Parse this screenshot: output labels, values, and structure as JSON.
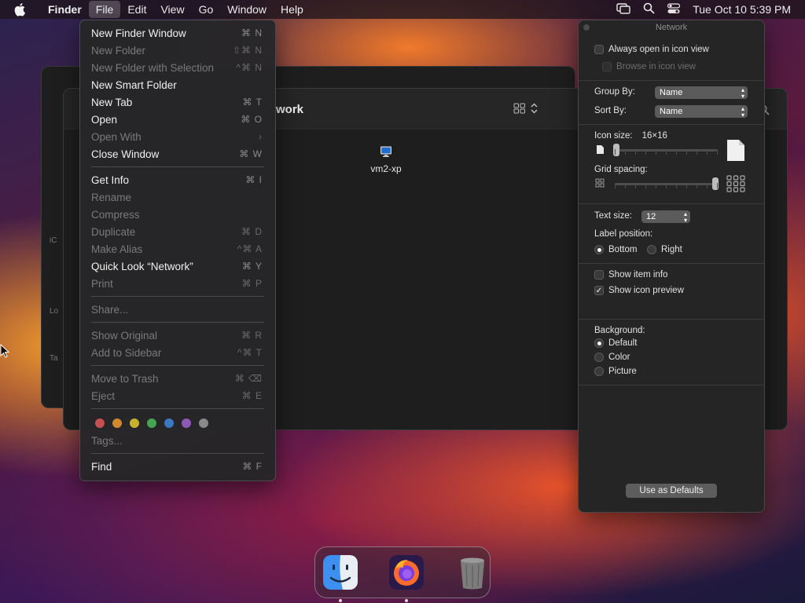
{
  "menubar": {
    "app_name": "Finder",
    "items": [
      "File",
      "Edit",
      "View",
      "Go",
      "Window",
      "Help"
    ],
    "clock": "Tue Oct 10  5:39 PM"
  },
  "finder_window": {
    "title_fragment": "work",
    "file_item": {
      "label": "vm2-xp"
    }
  },
  "background_window": {
    "ghost_labels": [
      "iC",
      "Lo",
      "Ta"
    ]
  },
  "file_menu": {
    "items": [
      {
        "label": "New Finder Window",
        "shortcut": "⌘ N",
        "enabled": true
      },
      {
        "label": "New Folder",
        "shortcut": "⇧⌘ N",
        "enabled": false
      },
      {
        "label": "New Folder with Selection",
        "shortcut": "^⌘ N",
        "enabled": false
      },
      {
        "label": "New Smart Folder",
        "shortcut": "",
        "enabled": true
      },
      {
        "label": "New Tab",
        "shortcut": "⌘ T",
        "enabled": true
      },
      {
        "label": "Open",
        "shortcut": "⌘ O",
        "enabled": true
      },
      {
        "label": "Open With",
        "shortcut": "›",
        "enabled": false
      },
      {
        "label": "Close Window",
        "shortcut": "⌘ W",
        "enabled": true
      },
      {
        "label": "Get Info",
        "shortcut": "⌘ I",
        "enabled": true
      },
      {
        "label": "Rename",
        "shortcut": "",
        "enabled": false
      },
      {
        "label": "Compress",
        "shortcut": "",
        "enabled": false
      },
      {
        "label": "Duplicate",
        "shortcut": "⌘ D",
        "enabled": false
      },
      {
        "label": "Make Alias",
        "shortcut": "^⌘ A",
        "enabled": false
      },
      {
        "label": "Quick Look “Network”",
        "shortcut": "⌘ Y",
        "enabled": true
      },
      {
        "label": "Print",
        "shortcut": "⌘ P",
        "enabled": false
      },
      {
        "label": "Share...",
        "shortcut": "",
        "enabled": false
      },
      {
        "label": "Show Original",
        "shortcut": "⌘ R",
        "enabled": false
      },
      {
        "label": "Add to Sidebar",
        "shortcut": "^⌘ T",
        "enabled": false
      },
      {
        "label": "Move to Trash",
        "shortcut": "⌘ ⌫",
        "enabled": false
      },
      {
        "label": "Eject",
        "shortcut": "⌘ E",
        "enabled": false
      },
      {
        "label": "Tags...",
        "shortcut": "",
        "enabled": false
      },
      {
        "label": "Find",
        "shortcut": "⌘ F",
        "enabled": true
      }
    ],
    "tag_colors": [
      "#c4504f",
      "#d08a2c",
      "#c9b22b",
      "#45a44f",
      "#3a78c2",
      "#8f58b8",
      "#8a8a8a"
    ]
  },
  "view_options": {
    "title": "Network",
    "always_open_icon_view": "Always open in icon view",
    "browse_icon_view": "Browse in icon view",
    "group_by_label": "Group By:",
    "group_by_value": "Name",
    "sort_by_label": "Sort By:",
    "sort_by_value": "Name",
    "icon_size_label": "Icon size:",
    "icon_size_value": "16×16",
    "grid_spacing_label": "Grid spacing:",
    "text_size_label": "Text size:",
    "text_size_value": "12",
    "label_position_label": "Label position:",
    "label_bottom": "Bottom",
    "label_right": "Right",
    "show_item_info": "Show item info",
    "show_icon_preview": "Show icon preview",
    "background_label": "Background:",
    "bg_default": "Default",
    "bg_color": "Color",
    "bg_picture": "Picture",
    "defaults_button": "Use as Defaults",
    "icon_size_level": 0.0,
    "grid_spacing_level": 1.0
  },
  "dock": {
    "apps": [
      "Finder",
      "Firefox",
      "Trash"
    ]
  }
}
